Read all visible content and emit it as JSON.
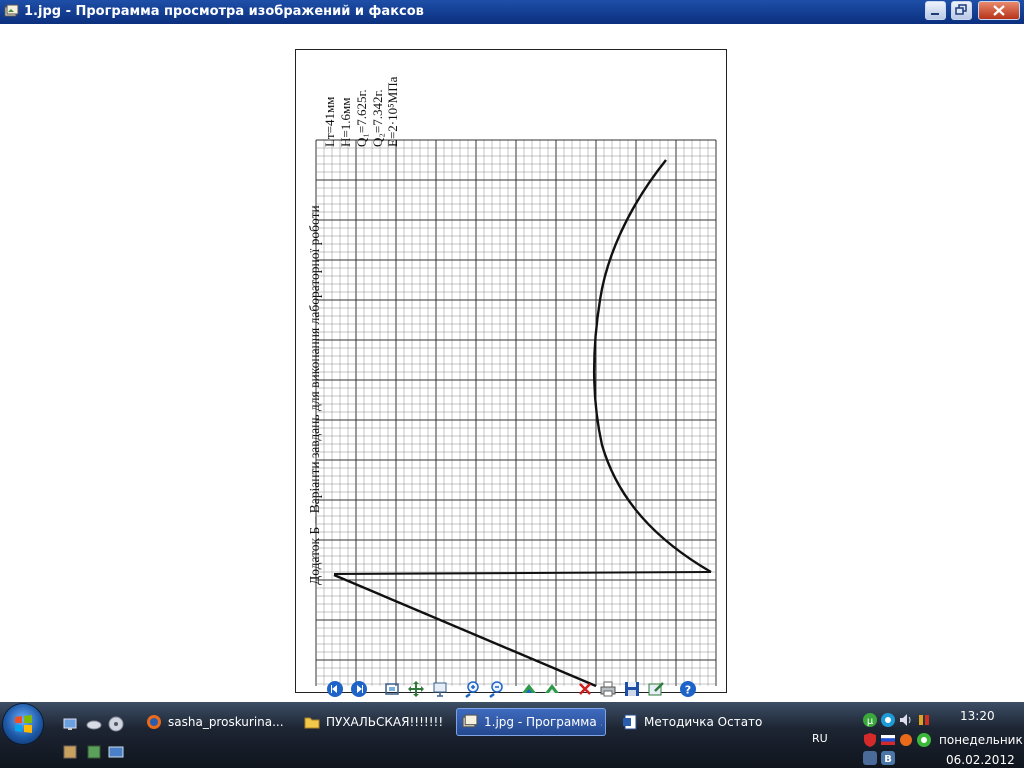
{
  "window": {
    "title": "1.jpg - Программа просмотра изображений и факсов"
  },
  "document": {
    "heading": "Додаток Б – Варіанти завдань для виконання лабораторної роботи",
    "params": [
      "Lт=41мм",
      "H=1.6мм",
      "Q₁=7.625г.",
      "Q₂=7.342г.",
      "E=2·10⁵МПа"
    ]
  },
  "toolbar": {
    "buttons": [
      "prev-image-icon",
      "next-image-icon",
      "best-fit-icon",
      "actual-size-icon",
      "slideshow-icon",
      "zoom-in-icon",
      "zoom-out-icon",
      "rotate-clockwise-icon",
      "rotate-counterclockwise-icon",
      "delete-icon",
      "print-icon",
      "save-icon",
      "edit-icon",
      "help-icon"
    ]
  },
  "taskbar": {
    "tasks": [
      {
        "label": "sasha_proskurina...",
        "icon": "firefox-icon",
        "active": false
      },
      {
        "label": "ПУХАЛЬСКАЯ!!!!!!!!!!!",
        "icon": "folder-icon",
        "active": false
      },
      {
        "label": "1.jpg - Программа ...",
        "icon": "image-viewer-icon",
        "active": true
      },
      {
        "label": "Методичка Остаточ...",
        "icon": "word-document-icon",
        "active": false
      }
    ],
    "language": "RU",
    "clock": {
      "time": "13:20",
      "day": "понедельник",
      "date": "06.02.2012"
    }
  },
  "colors": {
    "titlebar": "#0b2f7e",
    "taskbar": "#1d2533",
    "active_task": "#3f6cc0"
  }
}
